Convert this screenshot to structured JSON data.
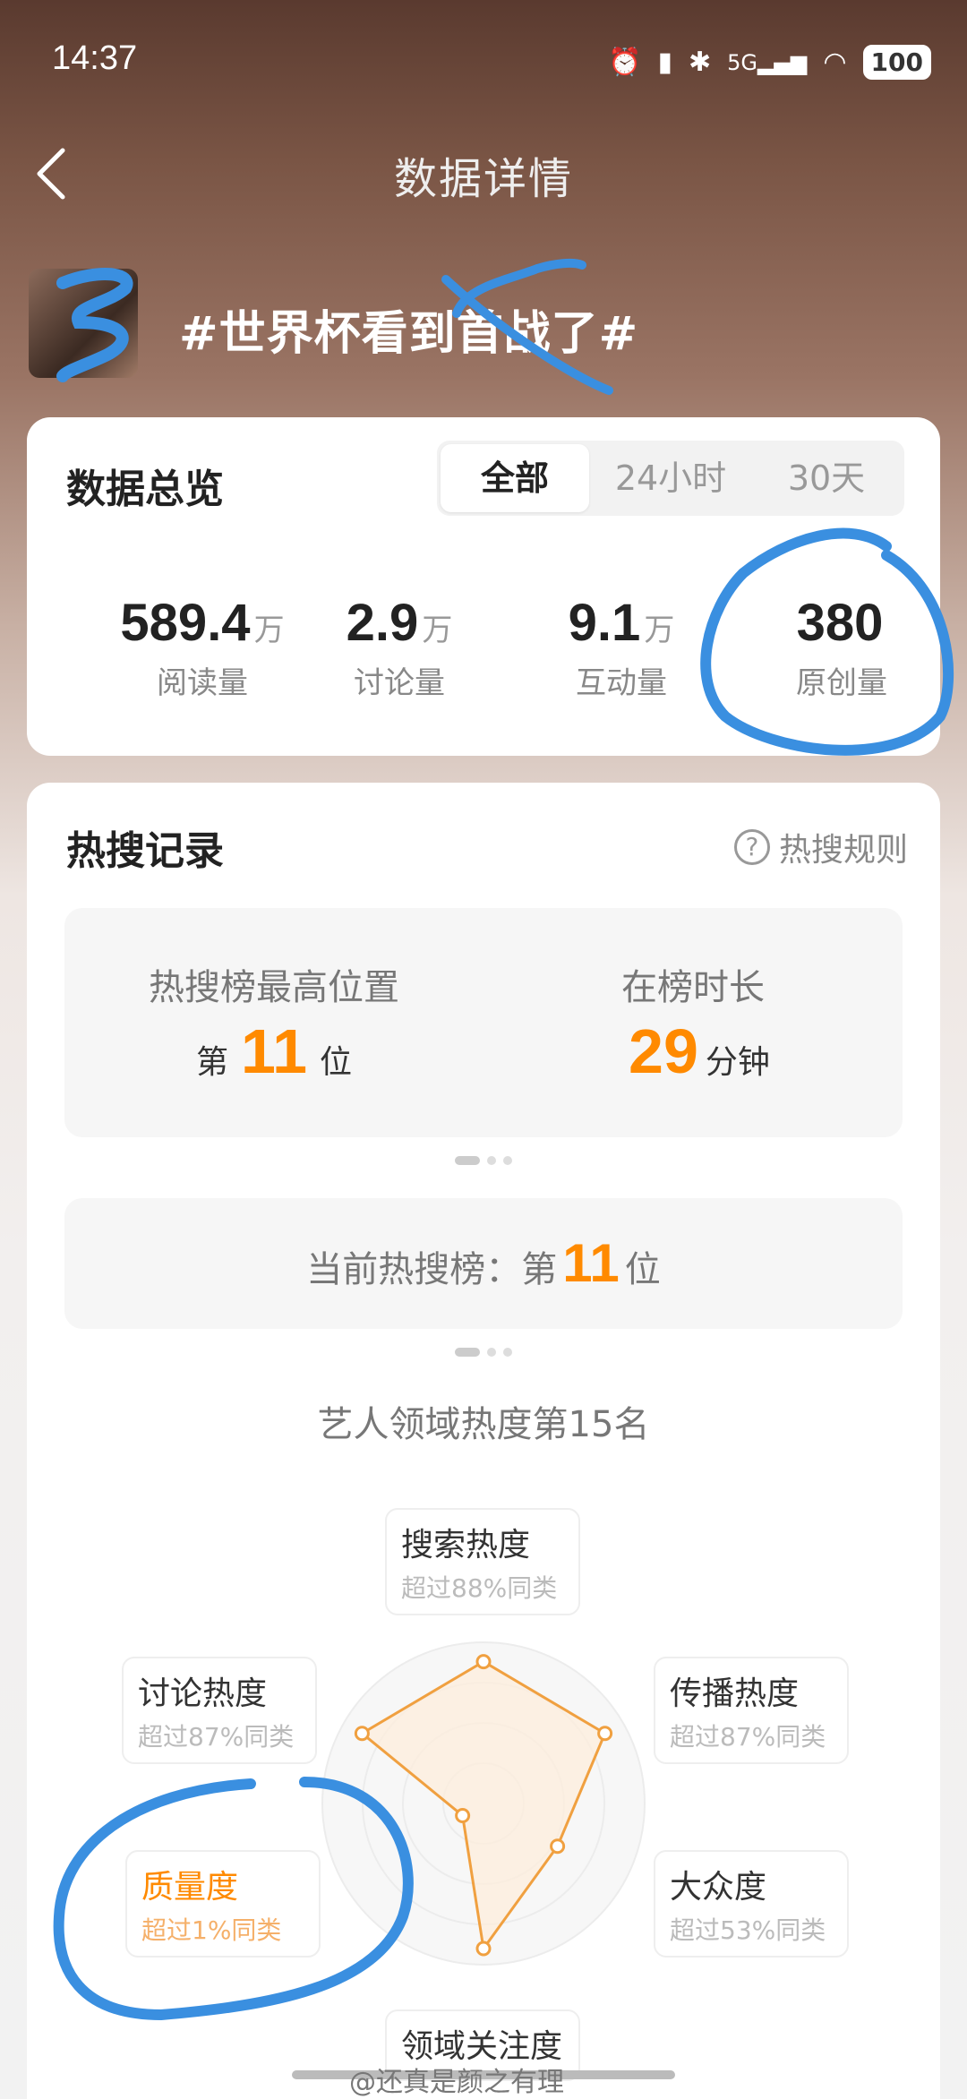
{
  "status": {
    "time": "14:37",
    "battery": "100",
    "network": "5G"
  },
  "nav": {
    "title": "数据详情"
  },
  "topic": {
    "title": "#世界杯看到首战了#"
  },
  "overview": {
    "title": "数据总览",
    "tabs": [
      "全部",
      "24小时",
      "30天"
    ],
    "active_tab": "全部",
    "stats": [
      {
        "value": "589.4",
        "unit": "万",
        "label": "阅读量"
      },
      {
        "value": "2.9",
        "unit": "万",
        "label": "讨论量"
      },
      {
        "value": "9.1",
        "unit": "万",
        "label": "互动量"
      },
      {
        "value": "380",
        "unit": "",
        "label": "原创量"
      }
    ]
  },
  "hot": {
    "title": "热搜记录",
    "rules_label": "热搜规则",
    "best_position_label": "热搜榜最高位置",
    "best_prefix": "第",
    "best_value": "11",
    "best_suffix": "位",
    "duration_label": "在榜时长",
    "duration_value": "29",
    "duration_unit": "分钟",
    "current_prefix": "当前热搜榜：第",
    "current_value": "11",
    "current_suffix": "位",
    "domain_rank": "艺人领域热度第15名"
  },
  "radar": {
    "axes": [
      {
        "name": "搜索热度",
        "sub": "超过88%同类",
        "level": 0.88
      },
      {
        "name": "传播热度",
        "sub": "超过87%同类",
        "level": 0.87
      },
      {
        "name": "大众度",
        "sub": "超过53%同类",
        "level": 0.53
      },
      {
        "name": "领域关注度",
        "sub": "",
        "level": 0.9
      },
      {
        "name": "质量度",
        "sub": "超过1%同类",
        "level": 0.15
      },
      {
        "name": "讨论热度",
        "sub": "超过87%同类",
        "level": 0.87
      }
    ],
    "colors": {
      "line": "#f0a040",
      "fill": "#fdeedd",
      "highlight": "#ff8a00"
    }
  },
  "watermark": "@还真是颜之有理"
}
